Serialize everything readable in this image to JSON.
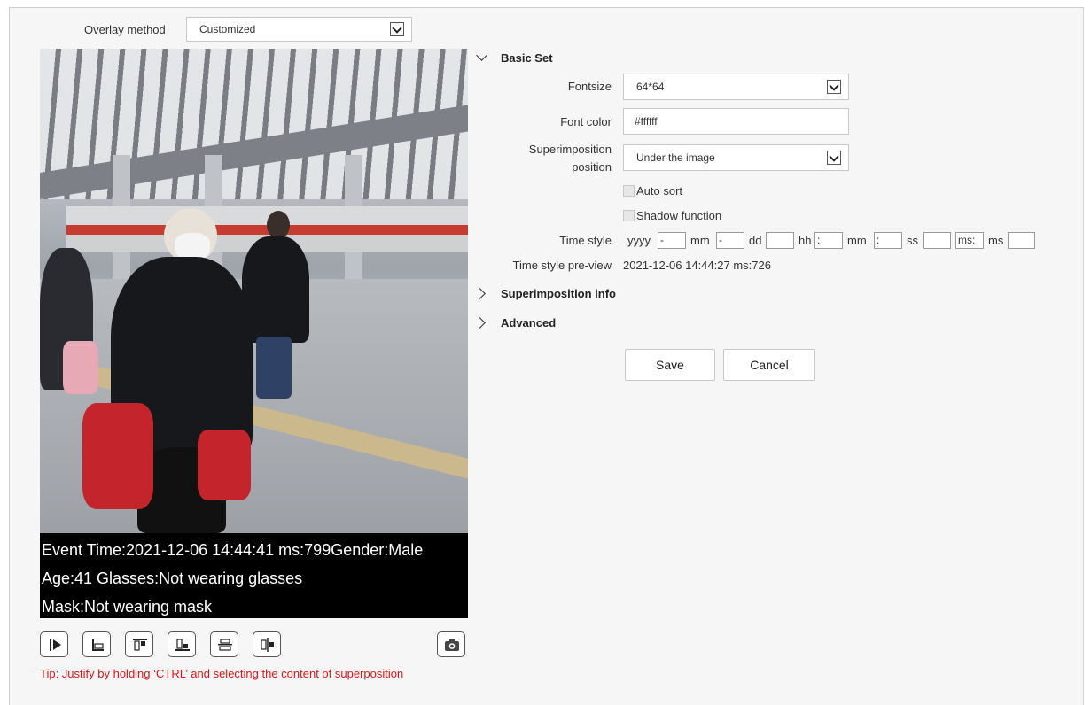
{
  "overlay_method": {
    "label": "Overlay method",
    "value": "Customized"
  },
  "preview": {
    "lines": [
      "Event Time:2021-12-06 14:44:41 ms:799Gender:Male",
      "Age:41  Glasses:Not wearing glasses",
      "Mask:Not wearing mask"
    ]
  },
  "toolbar": {
    "buttons": [
      "align-left",
      "align-bottom",
      "align-top",
      "align-baseline",
      "align-center-horizontal",
      "align-center-vertical"
    ],
    "snapshot": "camera"
  },
  "tip": "Tip: Justify by holding ‘CTRL’ and selecting the content of superposition",
  "basic_set": {
    "title": "Basic Set",
    "fontsize": {
      "label": "Fontsize",
      "value": "64*64"
    },
    "font_color": {
      "label": "Font color",
      "value": "#ffffff"
    },
    "position": {
      "label_line1": "Superimposition",
      "label_line2": "position",
      "value": "Under the image"
    },
    "auto_sort": {
      "label": "Auto sort",
      "checked": false
    },
    "shadow": {
      "label": "Shadow function",
      "checked": false
    },
    "time_style": {
      "label": "Time style",
      "units": [
        "yyyy",
        "mm",
        "dd",
        "hh",
        "mm",
        "ss",
        "ms"
      ],
      "separators": [
        "-",
        "-",
        "",
        ":",
        ":",
        "",
        "ms:",
        ""
      ]
    },
    "time_preview": {
      "label": "Time style pre-view",
      "value": "2021-12-06 14:44:27 ms:726"
    }
  },
  "superimposition_info": {
    "title": "Superimposition info"
  },
  "advanced": {
    "title": "Advanced"
  },
  "actions": {
    "save": "Save",
    "cancel": "Cancel"
  }
}
